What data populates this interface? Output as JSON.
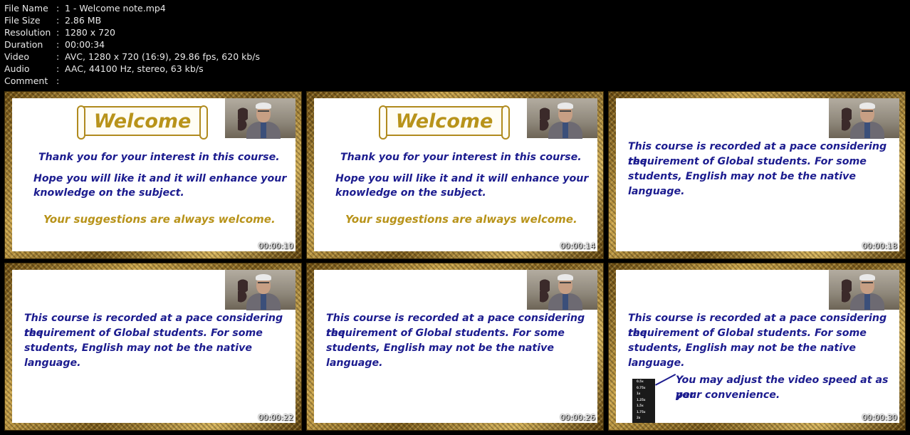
{
  "file_info": [
    {
      "key": "File Name",
      "sep": ":",
      "value": "1 - Welcome note.mp4"
    },
    {
      "key": "File Size",
      "sep": ":",
      "value": "2.86 MB"
    },
    {
      "key": "Resolution",
      "sep": ":",
      "value": "1280 x 720"
    },
    {
      "key": "Duration",
      "sep": ":",
      "value": "00:00:34"
    },
    {
      "key": "Video",
      "sep": ":",
      "value": "AVC, 1280 x 720 (16:9), 29.86 fps, 620 kb/s"
    },
    {
      "key": "Audio",
      "sep": ":",
      "value": "AAC, 44100 Hz, stereo, 63 kb/s"
    },
    {
      "key": "Comment",
      "sep": ":",
      "value": ""
    }
  ],
  "welcome": {
    "banner": "Welcome",
    "line1": "Thank you for your interest in this course.",
    "line2a": "Hope you will like it and it will enhance your",
    "line2b": "knowledge on the subject.",
    "line3": "Your suggestions are always welcome."
  },
  "pace": {
    "line1": "This course is recorded at a pace considering the",
    "line2": "requirement of Global students. For some",
    "line3": "students, English may not be the native language."
  },
  "speed_note": {
    "line1": "You may adjust the video speed at as per",
    "line2": "your convenience.",
    "options": [
      "0.5x",
      "0.75x",
      "1x",
      "1.25x",
      "1.5x",
      "1.75x",
      "2x"
    ]
  },
  "thumbnails": [
    {
      "timestamp": "00:00:10"
    },
    {
      "timestamp": "00:00:14"
    },
    {
      "timestamp": "00:00:18"
    },
    {
      "timestamp": "00:00:22"
    },
    {
      "timestamp": "00:00:26"
    },
    {
      "timestamp": "00:00:30"
    }
  ]
}
